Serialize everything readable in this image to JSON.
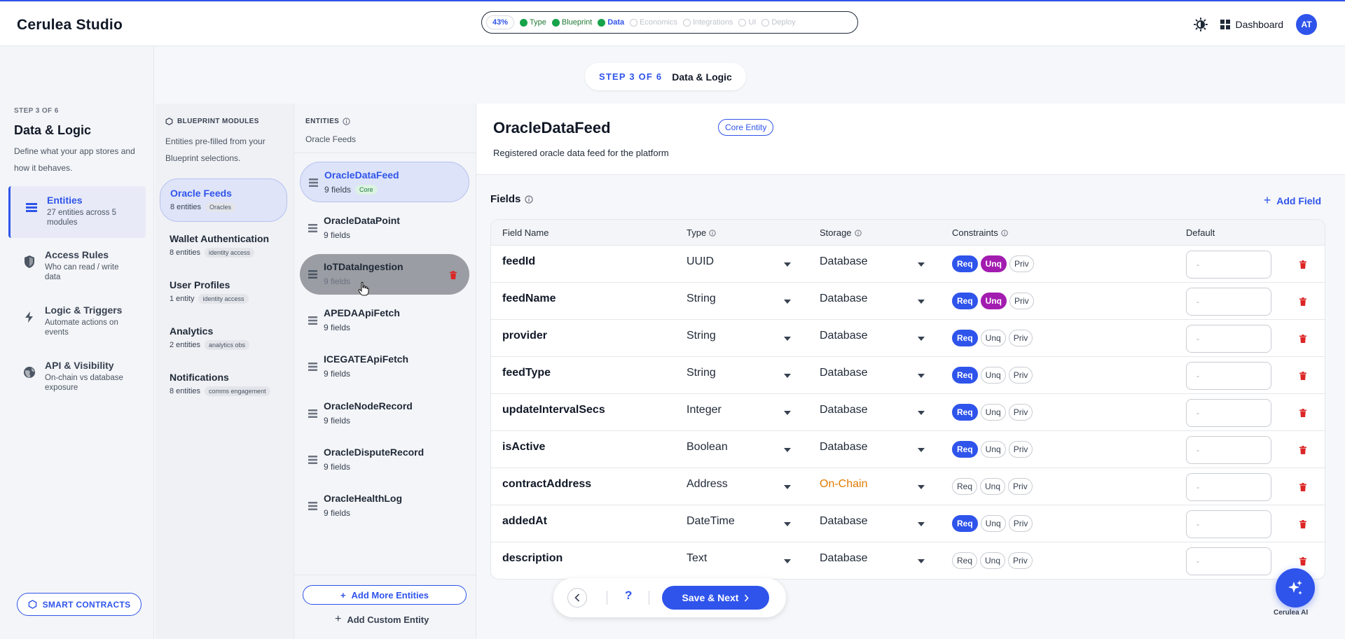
{
  "app": {
    "brand": "Cerulea Studio"
  },
  "progress": {
    "percent": "43%",
    "steps": [
      {
        "label": "Type",
        "state": "done"
      },
      {
        "label": "Blueprint",
        "state": "done"
      },
      {
        "label": "Data",
        "state": "active"
      },
      {
        "label": "Economics",
        "state": "todo"
      },
      {
        "label": "Integrations",
        "state": "todo"
      },
      {
        "label": "UI",
        "state": "todo"
      },
      {
        "label": "Deploy",
        "state": "todo"
      }
    ]
  },
  "header": {
    "dashboard_label": "Dashboard",
    "avatar_initials": "AT"
  },
  "step_pill": {
    "step": "STEP 3 OF 6",
    "title": "Data & Logic"
  },
  "leftnav": {
    "step": "STEP 3 OF 6",
    "title": "Data & Logic",
    "description": "Define what your app stores and how it behaves.",
    "items": [
      {
        "title": "Entities",
        "sub": "27 entities across 5 modules",
        "icon": "entities-icon"
      },
      {
        "title": "Access Rules",
        "sub": "Who can read / write data",
        "icon": "shield-icon"
      },
      {
        "title": "Logic & Triggers",
        "sub": "Automate actions on events",
        "icon": "lightning-icon"
      },
      {
        "title": "API & Visibility",
        "sub": "On-chain vs database exposure",
        "icon": "globe-icon"
      }
    ],
    "smart_contracts_label": "SMART CONTRACTS"
  },
  "modules": {
    "heading": "BLUEPRINT MODULES",
    "description": "Entities pre-filled from your Blueprint selections.",
    "items": [
      {
        "name": "Oracle Feeds",
        "count": "8 entities",
        "tag": "Oracles"
      },
      {
        "name": "Wallet Authentication",
        "count": "8 entities",
        "tag": "identity access"
      },
      {
        "name": "User Profiles",
        "count": "1 entity",
        "tag": "identity access"
      },
      {
        "name": "Analytics",
        "count": "2 entities",
        "tag": "analytics obs"
      },
      {
        "name": "Notifications",
        "count": "8 entities",
        "tag": "comms engagement"
      }
    ]
  },
  "entities": {
    "heading": "ENTITIES",
    "subheading": "Oracle Feeds",
    "items": [
      {
        "name": "OracleDataFeed",
        "fields": "9 fields",
        "tag": "Core"
      },
      {
        "name": "OracleDataPoint",
        "fields": "9 fields"
      },
      {
        "name": "IoTDataIngestion",
        "fields": "9 fields"
      },
      {
        "name": "APEDAApiFetch",
        "fields": "9 fields"
      },
      {
        "name": "ICEGATEApiFetch",
        "fields": "9 fields"
      },
      {
        "name": "OracleNodeRecord",
        "fields": "9 fields"
      },
      {
        "name": "OracleDisputeRecord",
        "fields": "9 fields"
      },
      {
        "name": "OracleHealthLog",
        "fields": "9 fields"
      }
    ],
    "add_more_label": "Add More Entities",
    "add_custom_label": "Add Custom Entity"
  },
  "entity": {
    "title": "OracleDataFeed",
    "badge": "Core Entity",
    "description": "Registered oracle data feed for the platform"
  },
  "fields": {
    "label": "Fields",
    "add_label": "Add Field",
    "columns": [
      "Field Name",
      "Type",
      "Storage",
      "Constraints",
      "Default"
    ],
    "constraint_labels": [
      "Req",
      "Unq",
      "Priv"
    ],
    "default_placeholder": "-",
    "rows": [
      {
        "name": "feedId",
        "type": "UUID",
        "storage": "Database",
        "req": true,
        "unq": true,
        "priv": false
      },
      {
        "name": "feedName",
        "type": "String",
        "storage": "Database",
        "req": true,
        "unq": true,
        "priv": false
      },
      {
        "name": "provider",
        "type": "String",
        "storage": "Database",
        "req": true,
        "unq": false,
        "priv": false
      },
      {
        "name": "feedType",
        "type": "String",
        "storage": "Database",
        "req": true,
        "unq": false,
        "priv": false
      },
      {
        "name": "updateIntervalSecs",
        "type": "Integer",
        "storage": "Database",
        "req": true,
        "unq": false,
        "priv": false
      },
      {
        "name": "isActive",
        "type": "Boolean",
        "storage": "Database",
        "req": true,
        "unq": false,
        "priv": false
      },
      {
        "name": "contractAddress",
        "type": "Address",
        "storage": "On-Chain",
        "req": false,
        "unq": false,
        "priv": false
      },
      {
        "name": "addedAt",
        "type": "DateTime",
        "storage": "Database",
        "req": true,
        "unq": false,
        "priv": false
      },
      {
        "name": "description",
        "type": "Text",
        "storage": "Database",
        "req": false,
        "unq": false,
        "priv": false
      }
    ]
  },
  "footer": {
    "help_label": "?",
    "save_label": "Save & Next"
  },
  "ai": {
    "label": "Cerulea AI"
  },
  "colors": {
    "accent": "#2f54eb",
    "unique": "#a21caf",
    "onchain": "#e07a00",
    "done": "#16a34a",
    "danger": "#dc2626"
  }
}
